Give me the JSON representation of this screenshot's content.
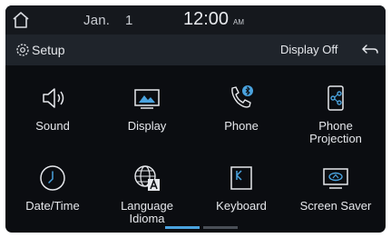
{
  "status": {
    "date": "Jan.",
    "day": "1",
    "time": "12:00",
    "ampm": "AM"
  },
  "header": {
    "title": "Setup",
    "display_off": "Display Off"
  },
  "tiles": [
    {
      "label": "Sound",
      "icon": "speaker-icon"
    },
    {
      "label": "Display",
      "icon": "display-icon"
    },
    {
      "label": "Phone",
      "icon": "bluetooth-phone-icon"
    },
    {
      "label": "Phone\nProjection",
      "icon": "phone-projection-icon"
    },
    {
      "label": "Date/Time",
      "icon": "clock-icon"
    },
    {
      "label": "Language\nIdioma",
      "icon": "language-globe-icon"
    },
    {
      "label": "Keyboard",
      "icon": "keyboard-icon"
    },
    {
      "label": "Screen Saver",
      "icon": "screen-saver-icon"
    }
  ],
  "colors": {
    "background": "#0b0d11",
    "header": "#1f242b",
    "accent": "#4aa3df"
  },
  "pagination": {
    "pages": 2,
    "current": 1
  }
}
